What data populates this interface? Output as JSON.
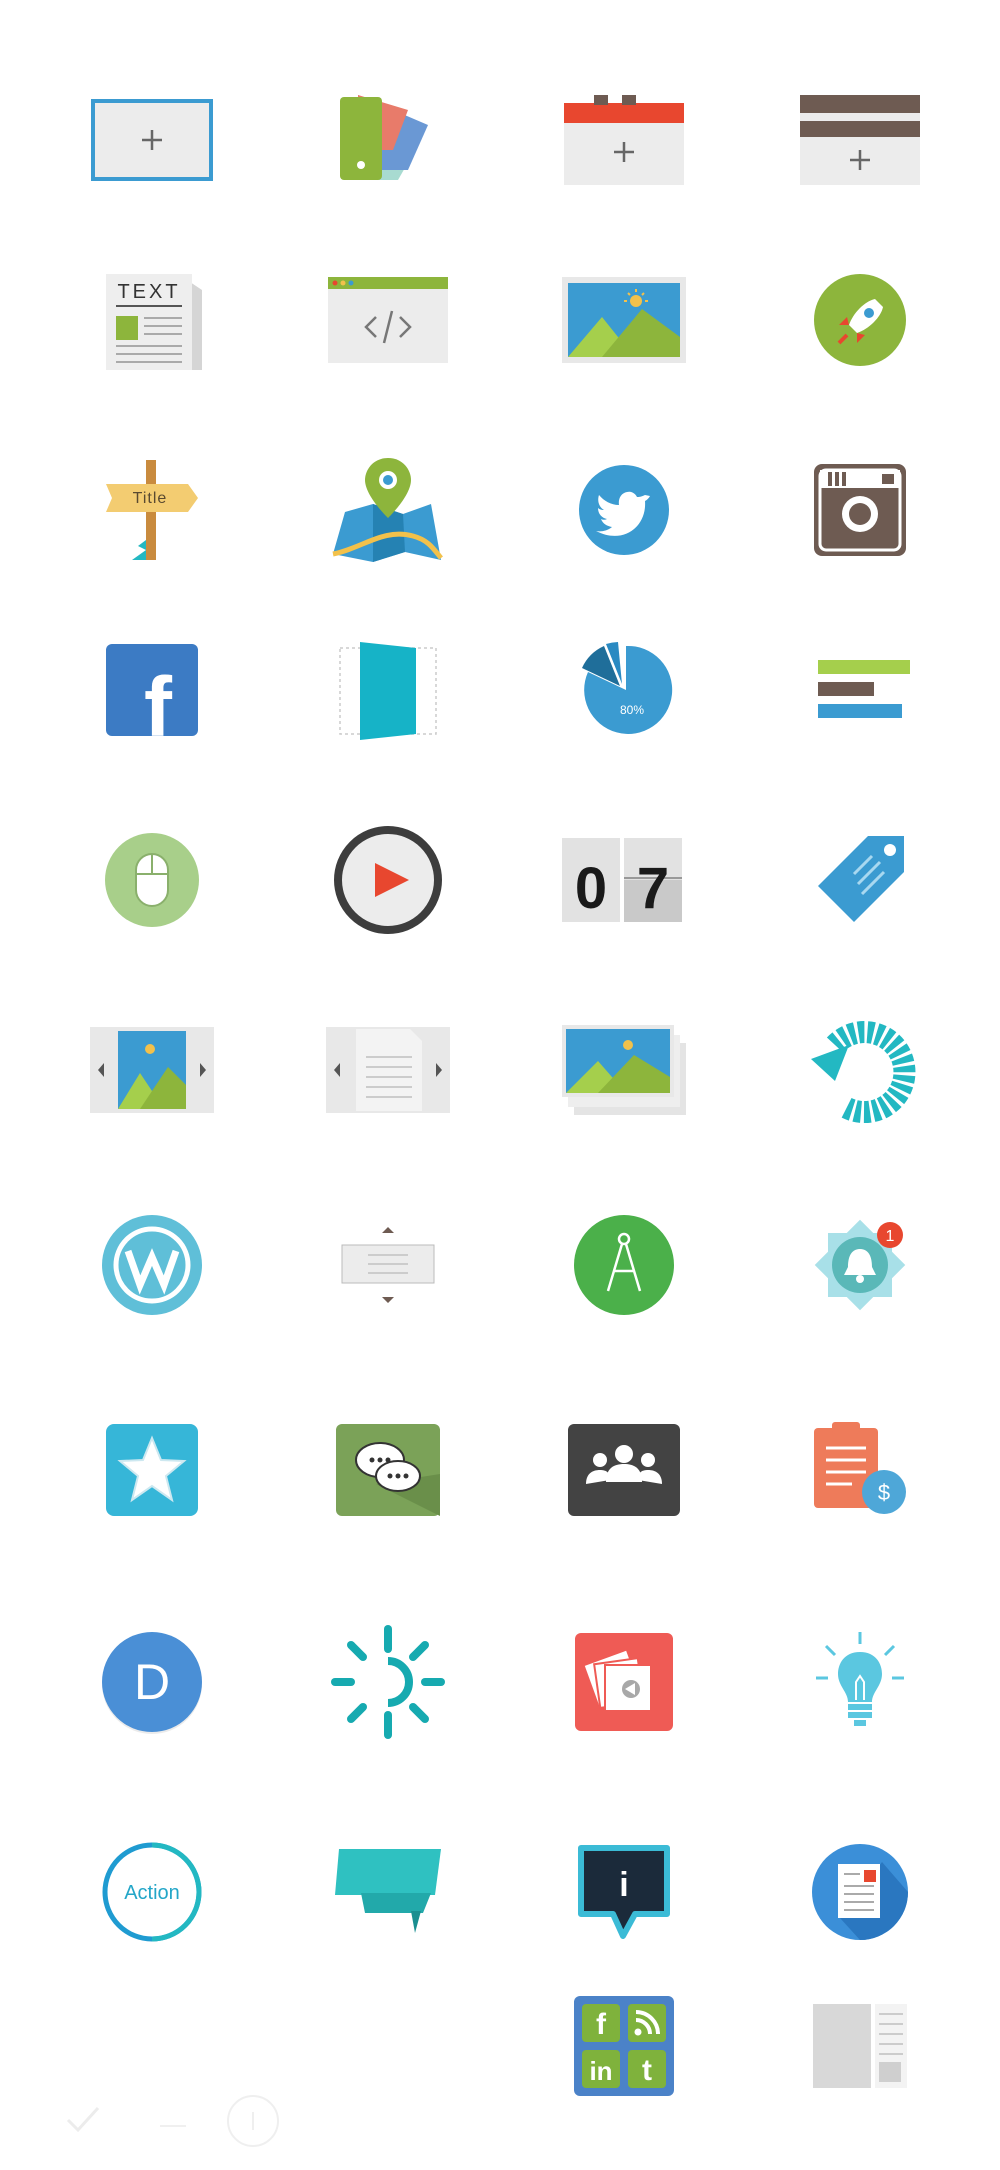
{
  "icons": {
    "text_label": "TEXT",
    "signpost_label": "Title",
    "pie_percent": "80%",
    "counter_digit_1": "0",
    "counter_digit_2": "7",
    "notification_count": "1",
    "dollar_sign": "$",
    "divi_letter": "D",
    "action_label": "Action",
    "info_letter": "i",
    "fb_letter": "f",
    "linkedin_label": "in",
    "twitter_letter": "t"
  },
  "colors": {
    "blue": "#3b9bd1",
    "green": "#8db53c",
    "red": "#e8472f",
    "brown": "#6e5b52",
    "teal": "#23b8c2",
    "gray": "#ececec"
  }
}
